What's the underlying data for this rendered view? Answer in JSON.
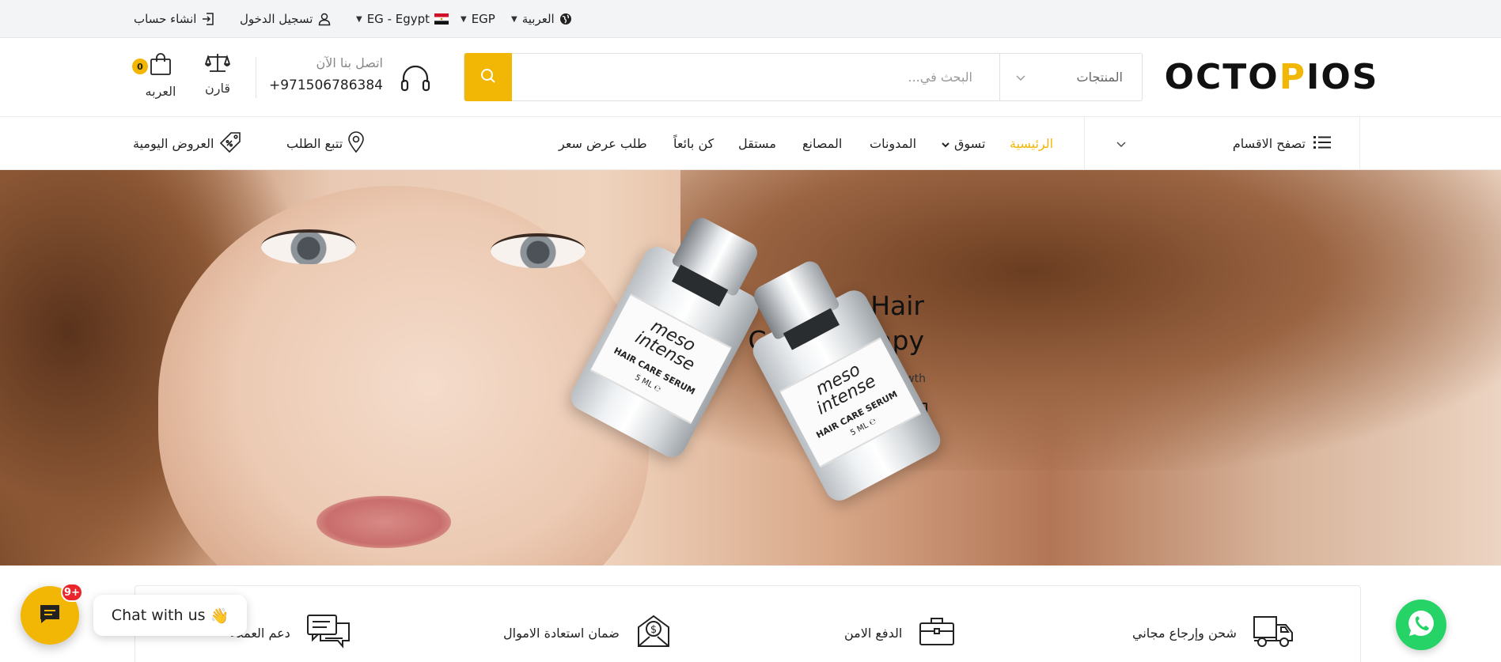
{
  "topbar": {
    "language": "العربية",
    "currency": "EGP",
    "country": "EG - Egypt",
    "login": "تسجيل الدخول",
    "register": "انشاء حساب"
  },
  "header": {
    "logo_part1": "OCTO",
    "logo_part2": "P",
    "logo_part3": "IOS",
    "search_placeholder": "البحث في...",
    "category_select": "المنتجات",
    "contact_label": "اتصل بنا الآن",
    "contact_phone": "+971506786384",
    "compare_label": "قارن",
    "cart_label": "العربه",
    "cart_count": "0"
  },
  "nav": {
    "browse_label": "تصفح الاقسام",
    "links": [
      {
        "label": "الرئيسية",
        "active": true
      },
      {
        "label": "تسوق",
        "has_dropdown": true
      },
      {
        "label": "المدونات"
      },
      {
        "label": "المصانع"
      },
      {
        "label": "مستقل"
      },
      {
        "label": "كن بائعاً"
      },
      {
        "label": "طلب عرض سعر"
      }
    ],
    "track_order": "تتبع الطلب",
    "daily_deals": "العروض اليومية"
  },
  "hero": {
    "title": "Meso Intense Hair Care Therapy",
    "subtitle": "growth",
    "vial_brand": "meso intense",
    "vial_product": "HAIR CARE SERUM",
    "vial_volume": "5 ML ℮"
  },
  "features": [
    {
      "label": "شحن وإرجاع مجاني",
      "icon": "truck-icon"
    },
    {
      "label": "الدفع الامن",
      "icon": "briefcase-icon"
    },
    {
      "label": "ضمان استعادة الاموال",
      "icon": "money-envelope-icon"
    },
    {
      "label": "دعم العملاء",
      "icon": "chat-bubbles-icon"
    }
  ],
  "chat": {
    "badge": "9+",
    "label": "Chat with us",
    "emoji": "👋"
  },
  "colors": {
    "accent": "#f2b705",
    "topbar_bg": "#f3f4f6",
    "whatsapp": "#25d366"
  }
}
